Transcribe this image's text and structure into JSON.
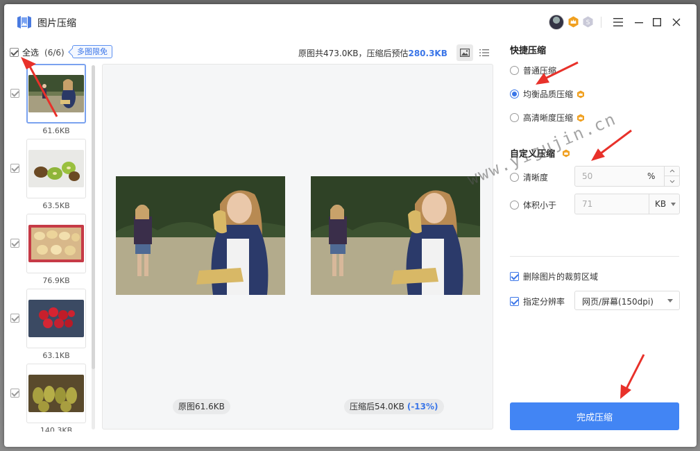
{
  "app": {
    "title": "图片压缩"
  },
  "colors": {
    "accent": "#3b76e8",
    "button": "#4285f4",
    "vip": "#f0a020",
    "arrow": "#e8312a"
  },
  "icons": {
    "logo": "image-compress-logo-icon",
    "menu": "hamburger-menu-icon",
    "minimize": "minimize-icon",
    "maximize": "maximize-icon",
    "close": "close-icon",
    "vip": "crown-vip-icon",
    "svip": "svip-badge-icon"
  },
  "list": {
    "select_all_label": "全选",
    "select_all_count": "(6/6)",
    "free_badge": "多图限免",
    "items": [
      {
        "size": "61.6KB",
        "checked": true,
        "active": true
      },
      {
        "size": "63.5KB",
        "checked": true
      },
      {
        "size": "76.9KB",
        "checked": true
      },
      {
        "size": "63.1KB",
        "checked": true
      },
      {
        "size": "140.3KB",
        "checked": true
      }
    ]
  },
  "summary": {
    "prefix": "原图共473.0KB，压缩后预估",
    "value": "280.3KB"
  },
  "preview": {
    "original_label": "原图61.6KB",
    "compressed_label": "压缩后54.0KB",
    "compressed_pct": "(-13%)"
  },
  "quick": {
    "title": "快捷压缩",
    "options": [
      {
        "label": "普通压缩",
        "selected": false,
        "vip": false
      },
      {
        "label": "均衡品质压缩",
        "selected": true,
        "vip": true
      },
      {
        "label": "高清晰度压缩",
        "selected": false,
        "vip": true
      }
    ]
  },
  "custom": {
    "title": "自定义压缩",
    "clarity_label": "清晰度",
    "clarity_value": "50",
    "clarity_unit": "%",
    "size_label": "体积小于",
    "size_value": "71",
    "size_unit": "KB"
  },
  "options": {
    "remove_crop_label": "删除图片的裁剪区域",
    "resolution_label": "指定分辨率",
    "resolution_value": "网页/屏幕(150dpi)"
  },
  "finish_button": "完成压缩",
  "watermark": "www.yigujin.cn"
}
